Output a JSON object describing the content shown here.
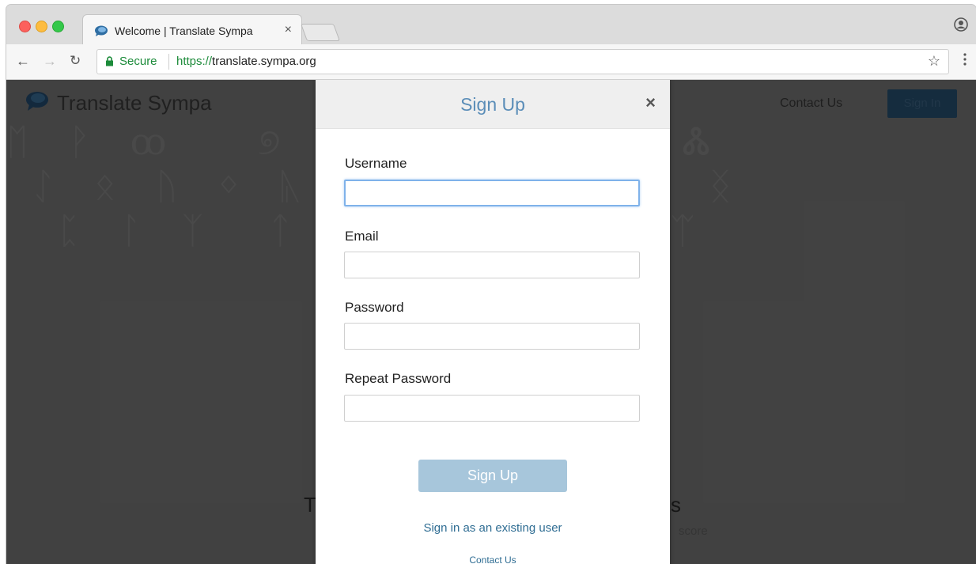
{
  "browser": {
    "tab_title": "Welcome | Translate Sympa",
    "tab_close": "×",
    "secure_label": "Secure",
    "url_scheme": "https://",
    "url_rest": "translate.sympa.org"
  },
  "site": {
    "name": "Translate Sympa",
    "contact": "Contact Us",
    "signin": "Sign In",
    "partial_heading_left": "T",
    "partial_heading_right": "s",
    "partial_score": "score",
    "background_glyphs": "ᛖ ᚹ ꝏ   ୭ ሀ   ᚡ  ᎣᎢ ᒥ Ꮬ\n ᛇ ᛟ ᚢ ᛜ ᚣ   ᛞ Ꭾ  ᏑᏀ Ꮓ ᛝ\n  ᛈ ᛚ ᛉ  ᛏ      ᛗ  ᛄ ᛟ ᛠ"
  },
  "modal": {
    "title": "Sign Up",
    "close": "×",
    "fields": [
      {
        "label": "Username",
        "value": ""
      },
      {
        "label": "Email",
        "value": ""
      },
      {
        "label": "Password",
        "value": ""
      },
      {
        "label": "Repeat Password",
        "value": ""
      }
    ],
    "submit": "Sign Up",
    "existing_user_link": "Sign in as an existing user",
    "contact": "Contact Us"
  },
  "colors": {
    "modal_title": "#5a8db8",
    "link": "#2f6d93",
    "submit_bg": "#a7c6db",
    "secure_green": "#1c8b3a"
  },
  "icons": {
    "tab_favicon": "speech-bubble-icon",
    "lock": "lock-icon",
    "star": "star-icon",
    "profile": "profile-icon",
    "menu": "more-vertical-icon"
  }
}
